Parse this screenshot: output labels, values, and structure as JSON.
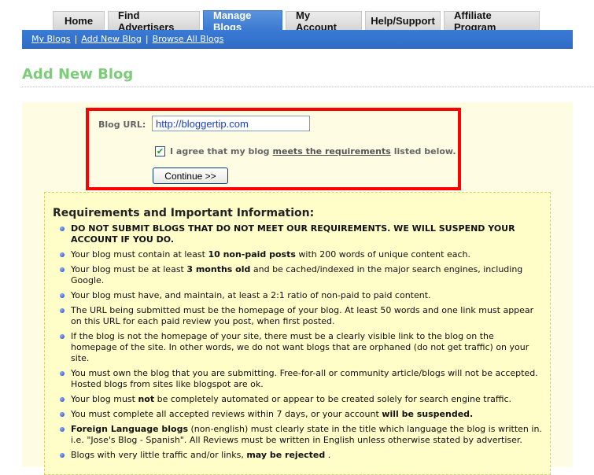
{
  "nav": {
    "tabs": [
      {
        "label": "Home",
        "active": false
      },
      {
        "label": "Find Advertisers",
        "active": false
      },
      {
        "label": "Manage Blogs",
        "active": true
      },
      {
        "label": "My Account",
        "active": false
      },
      {
        "label": "Help/Support",
        "active": false
      },
      {
        "label": "Affiliate Program",
        "active": false
      }
    ],
    "subnav": [
      {
        "label": "My Blogs"
      },
      {
        "label": "Add New Blog"
      },
      {
        "label": "Browse All Blogs"
      }
    ],
    "separator": "|"
  },
  "page": {
    "title": "Add New Blog",
    "title_color": "#7ccc7a"
  },
  "form": {
    "url_label": "Blog URL:",
    "url_value": "http://bloggertip.com",
    "agree_checked": true,
    "agree_prefix": "I agree that my blog",
    "agree_link": "meets the requirements",
    "agree_suffix": "listed below.",
    "continue_label": "Continue >>",
    "highlight_color": "#ff0000"
  },
  "requirements": {
    "title": "Requirements and Important Information:",
    "items": [
      {
        "parts": [
          {
            "text": "DO NOT SUBMIT BLOGS THAT DO NOT MEET OUR REQUIREMENTS. WE WILL SUSPEND YOUR ACCOUNT IF YOU DO.",
            "bold": true
          }
        ]
      },
      {
        "parts": [
          {
            "text": "Your blog must contain at least "
          },
          {
            "text": "10 non-paid posts",
            "bold": true
          },
          {
            "text": " with 200 words of unique content each."
          }
        ]
      },
      {
        "parts": [
          {
            "text": "Your blog must be at least "
          },
          {
            "text": "3 months old",
            "bold": true
          },
          {
            "text": " and be cached/indexed in the major search engines, including Google."
          }
        ]
      },
      {
        "parts": [
          {
            "text": "Your blog must have, and maintain, at least a 2:1 ratio of non-paid to paid content."
          }
        ]
      },
      {
        "parts": [
          {
            "text": "The URL being submitted must be the homepage of your blog. At least 50 words and one link must appear on this URL for each paid review you post, when first posted."
          }
        ]
      },
      {
        "parts": [
          {
            "text": "If the blog is not the homepage of your site, there must be a clearly visible link to the blog on the homepage of the site. In other words, we do not want blogs that are orphaned (do not get traffic) on your site."
          }
        ]
      },
      {
        "parts": [
          {
            "text": "You must own the blog that you are submitting. Free-for-all or community article/blogs will not be accepted. Hosted blogs from sites like blogspot are ok."
          }
        ]
      },
      {
        "parts": [
          {
            "text": "Your blog must "
          },
          {
            "text": "not",
            "bold": true
          },
          {
            "text": " be completely automated or appear to be created solely for search engine traffic."
          }
        ]
      },
      {
        "parts": [
          {
            "text": "You must complete all accepted reviews within 7 days, or your account "
          },
          {
            "text": "will be suspended.",
            "bold": true
          }
        ]
      },
      {
        "parts": [
          {
            "text": "Foreign Language blogs",
            "bold": true
          },
          {
            "text": " (non-english) must clearly state in the title which language the blog is written in. i.e. \"Jose's Blog - Spanish\". All Reviews must be written in English unless otherwise stated by advertiser."
          }
        ]
      },
      {
        "parts": [
          {
            "text": "Blogs with very little traffic and/or links, "
          },
          {
            "text": "may be rejected",
            "bold": true
          },
          {
            "text": " ."
          }
        ]
      }
    ]
  }
}
